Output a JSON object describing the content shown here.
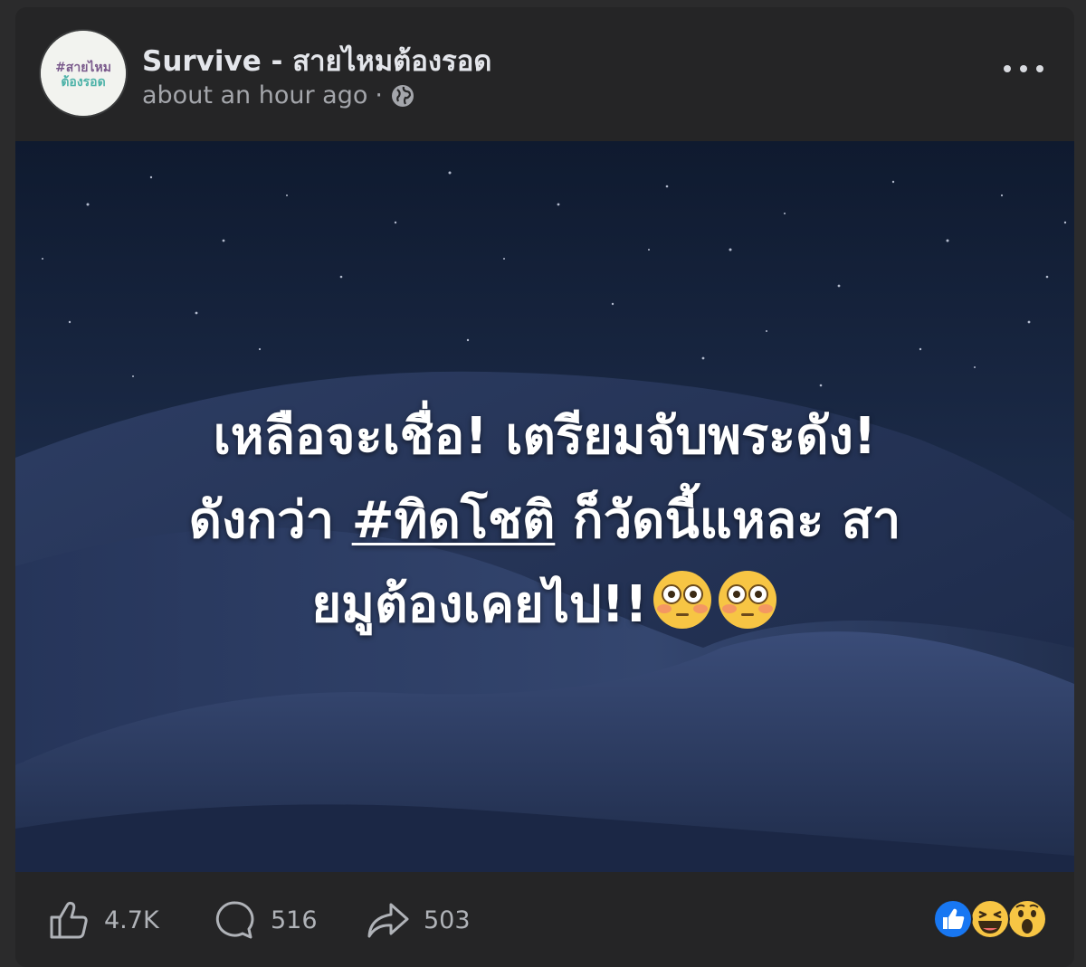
{
  "post": {
    "page_name": "Survive - สายไหมต้องรอด",
    "avatar_text_line1": "#สายไหม",
    "avatar_text_line2": "ต้องรอด",
    "timestamp": "about an hour ago",
    "separator": "·",
    "privacy_icon": "globe-icon",
    "more_icon": "more-options-icon"
  },
  "image_text": {
    "line1": "เหลือจะเชื่อ! เตรียมจับพระดัง!",
    "line2_prefix": "ดังกว่า ",
    "hashtag": "#ทิดโชติ",
    "line2_suffix": " ก็วัดนี้แหละ สา",
    "line3": "ยมูต้องเคยไป!!",
    "emoji_icons": [
      "flushed-face-icon",
      "flushed-face-icon"
    ]
  },
  "actions": {
    "likes": "4.7K",
    "comments": "516",
    "shares": "503"
  },
  "reactions": [
    "like-icon",
    "haha-icon",
    "wow-icon"
  ],
  "colors": {
    "card_bg": "#252526",
    "text_primary": "#e4e6eb",
    "text_secondary": "#b0b3b8",
    "like_blue": "#1877f2",
    "reaction_yellow": "#f7c544"
  }
}
